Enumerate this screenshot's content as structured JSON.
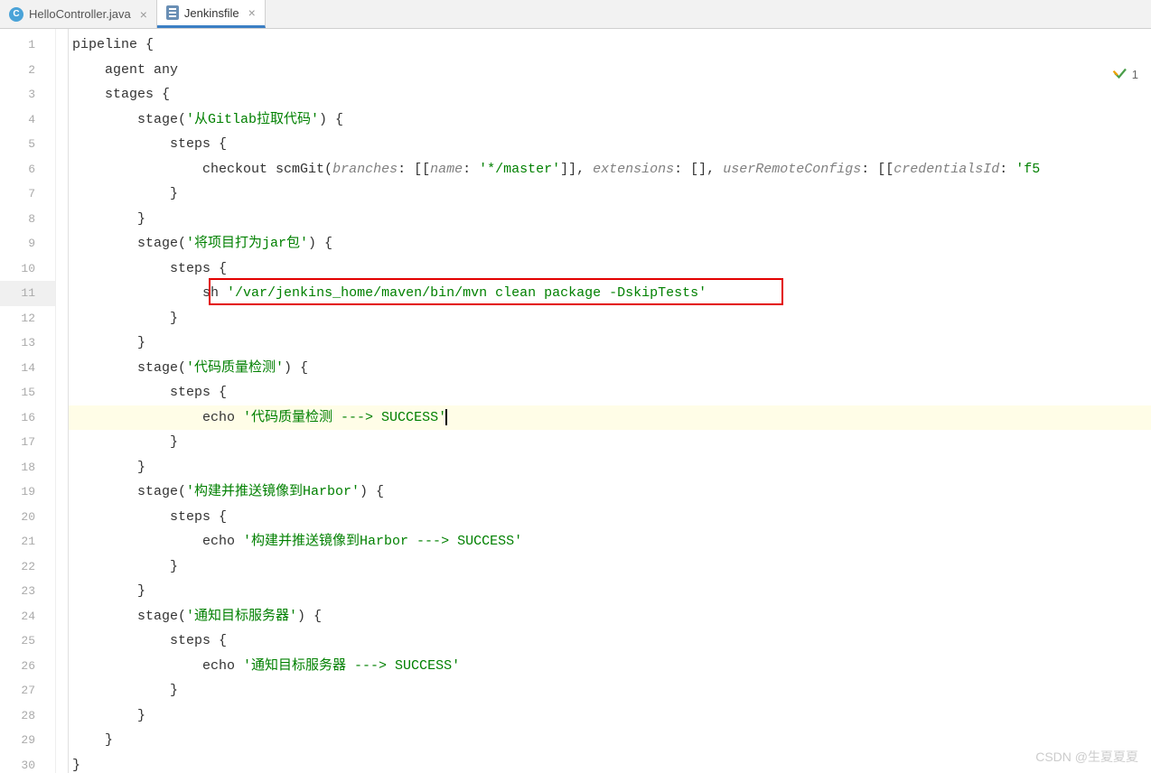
{
  "tabs": [
    {
      "label": "HelloController.java",
      "iconType": "c",
      "active": false
    },
    {
      "label": "Jenkinsfile",
      "iconType": "j",
      "active": true
    }
  ],
  "indicator": {
    "count": "1"
  },
  "watermark": "CSDN @生夏夏夏",
  "highlightedLineNumber": 16,
  "currentLineNumber": 11,
  "redBox": {
    "line": 11
  },
  "code": {
    "lines": [
      {
        "n": 1,
        "indent": 0,
        "tokens": [
          {
            "t": "pipeline {",
            "c": "kw"
          }
        ]
      },
      {
        "n": 2,
        "indent": 1,
        "tokens": [
          {
            "t": "agent any",
            "c": "kw"
          }
        ]
      },
      {
        "n": 3,
        "indent": 1,
        "tokens": [
          {
            "t": "stages {",
            "c": "kw"
          }
        ]
      },
      {
        "n": 4,
        "indent": 2,
        "tokens": [
          {
            "t": "stage(",
            "c": "fn"
          },
          {
            "t": "'从Gitlab拉取代码'",
            "c": "str"
          },
          {
            "t": ") {",
            "c": "kw"
          }
        ]
      },
      {
        "n": 5,
        "indent": 3,
        "tokens": [
          {
            "t": "steps {",
            "c": "kw"
          }
        ]
      },
      {
        "n": 6,
        "indent": 4,
        "tokens": [
          {
            "t": "checkout scmGit(",
            "c": "fn"
          },
          {
            "t": "branches",
            "c": "param-it"
          },
          {
            "t": ": [[",
            "c": "kw"
          },
          {
            "t": "name",
            "c": "param-it"
          },
          {
            "t": ": ",
            "c": "kw"
          },
          {
            "t": "'*/master'",
            "c": "str"
          },
          {
            "t": "]], ",
            "c": "kw"
          },
          {
            "t": "extensions",
            "c": "param-it"
          },
          {
            "t": ": [], ",
            "c": "kw"
          },
          {
            "t": "userRemoteConfigs",
            "c": "param-it"
          },
          {
            "t": ": [[",
            "c": "kw"
          },
          {
            "t": "credentialsId",
            "c": "param-it"
          },
          {
            "t": ": ",
            "c": "kw"
          },
          {
            "t": "'f5",
            "c": "str"
          }
        ]
      },
      {
        "n": 7,
        "indent": 3,
        "tokens": [
          {
            "t": "}",
            "c": "kw"
          }
        ]
      },
      {
        "n": 8,
        "indent": 2,
        "tokens": [
          {
            "t": "}",
            "c": "kw"
          }
        ]
      },
      {
        "n": 9,
        "indent": 2,
        "tokens": [
          {
            "t": "stage(",
            "c": "fn"
          },
          {
            "t": "'将项目打为jar包'",
            "c": "str"
          },
          {
            "t": ") {",
            "c": "kw"
          }
        ]
      },
      {
        "n": 10,
        "indent": 3,
        "tokens": [
          {
            "t": "steps {",
            "c": "kw"
          }
        ]
      },
      {
        "n": 11,
        "indent": 4,
        "tokens": [
          {
            "t": "sh ",
            "c": "fn"
          },
          {
            "t": "'/var/jenkins_home/maven/bin/mvn clean package -DskipTests'",
            "c": "str"
          }
        ]
      },
      {
        "n": 12,
        "indent": 3,
        "tokens": [
          {
            "t": "}",
            "c": "kw"
          }
        ]
      },
      {
        "n": 13,
        "indent": 2,
        "tokens": [
          {
            "t": "}",
            "c": "kw"
          }
        ]
      },
      {
        "n": 14,
        "indent": 2,
        "tokens": [
          {
            "t": "stage(",
            "c": "fn"
          },
          {
            "t": "'代码质量检测'",
            "c": "str"
          },
          {
            "t": ") {",
            "c": "kw"
          }
        ]
      },
      {
        "n": 15,
        "indent": 3,
        "tokens": [
          {
            "t": "steps {",
            "c": "kw"
          }
        ]
      },
      {
        "n": 16,
        "indent": 4,
        "tokens": [
          {
            "t": "echo ",
            "c": "fn"
          },
          {
            "t": "'代码质量检测 ---> SUCCESS'",
            "c": "str"
          }
        ],
        "cursor": true
      },
      {
        "n": 17,
        "indent": 3,
        "tokens": [
          {
            "t": "}",
            "c": "kw"
          }
        ]
      },
      {
        "n": 18,
        "indent": 2,
        "tokens": [
          {
            "t": "}",
            "c": "kw"
          }
        ]
      },
      {
        "n": 19,
        "indent": 2,
        "tokens": [
          {
            "t": "stage(",
            "c": "fn"
          },
          {
            "t": "'构建并推送镜像到Harbor'",
            "c": "str"
          },
          {
            "t": ") {",
            "c": "kw"
          }
        ]
      },
      {
        "n": 20,
        "indent": 3,
        "tokens": [
          {
            "t": "steps {",
            "c": "kw"
          }
        ]
      },
      {
        "n": 21,
        "indent": 4,
        "tokens": [
          {
            "t": "echo ",
            "c": "fn"
          },
          {
            "t": "'构建并推送镜像到Harbor ---> SUCCESS'",
            "c": "str"
          }
        ]
      },
      {
        "n": 22,
        "indent": 3,
        "tokens": [
          {
            "t": "}",
            "c": "kw"
          }
        ]
      },
      {
        "n": 23,
        "indent": 2,
        "tokens": [
          {
            "t": "}",
            "c": "kw"
          }
        ]
      },
      {
        "n": 24,
        "indent": 2,
        "tokens": [
          {
            "t": "stage(",
            "c": "fn"
          },
          {
            "t": "'通知目标服务器'",
            "c": "str"
          },
          {
            "t": ") {",
            "c": "kw"
          }
        ]
      },
      {
        "n": 25,
        "indent": 3,
        "tokens": [
          {
            "t": "steps {",
            "c": "kw"
          }
        ]
      },
      {
        "n": 26,
        "indent": 4,
        "tokens": [
          {
            "t": "echo ",
            "c": "fn"
          },
          {
            "t": "'通知目标服务器 ---> SUCCESS'",
            "c": "str"
          }
        ]
      },
      {
        "n": 27,
        "indent": 3,
        "tokens": [
          {
            "t": "}",
            "c": "kw"
          }
        ]
      },
      {
        "n": 28,
        "indent": 2,
        "tokens": [
          {
            "t": "}",
            "c": "kw"
          }
        ]
      },
      {
        "n": 29,
        "indent": 1,
        "tokens": [
          {
            "t": "}",
            "c": "kw"
          }
        ]
      },
      {
        "n": 30,
        "indent": 0,
        "tokens": [
          {
            "t": "}",
            "c": "kw"
          }
        ]
      }
    ]
  }
}
